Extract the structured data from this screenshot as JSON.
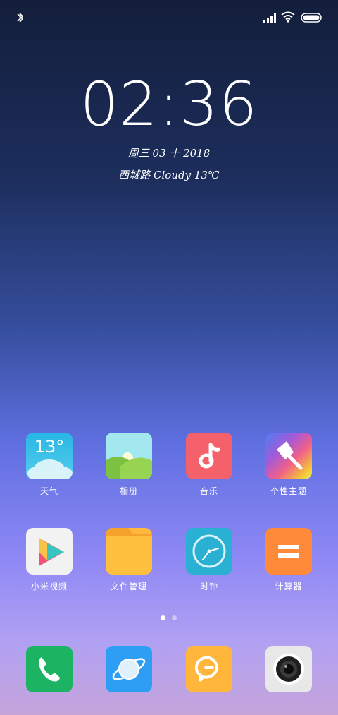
{
  "status_bar": {
    "icons": [
      "bluetooth-icon",
      "signal-icon",
      "wifi-icon",
      "battery-icon"
    ]
  },
  "lockscreen": {
    "time": "02:36",
    "date": "周三 03 十 2018",
    "weather": "西城路 Cloudy 13℃"
  },
  "apps_row1": [
    {
      "label": "天气",
      "icon": "weather-icon",
      "temp": "13°"
    },
    {
      "label": "相册",
      "icon": "gallery-icon"
    },
    {
      "label": "音乐",
      "icon": "music-icon"
    },
    {
      "label": "个性主题",
      "icon": "themes-icon"
    }
  ],
  "apps_row2": [
    {
      "label": "小米视频",
      "icon": "video-icon"
    },
    {
      "label": "文件管理",
      "icon": "file-manager-icon"
    },
    {
      "label": "时钟",
      "icon": "clock-icon"
    },
    {
      "label": "计算器",
      "icon": "calculator-icon"
    }
  ],
  "page_indicator": {
    "active": 1,
    "total": 2
  },
  "dock": [
    {
      "icon": "phone-icon"
    },
    {
      "icon": "browser-icon"
    },
    {
      "icon": "messages-icon"
    },
    {
      "icon": "camera-icon"
    }
  ],
  "colors": {
    "weather": "#3fc1e6",
    "gallery_sky": "#9fe6ef",
    "gallery_hill": "#8ccf45",
    "music": "#f5626b",
    "file": "#ffb93f",
    "clock": "#2fb2d4",
    "calculator": "#ff8a3a",
    "phone": "#1db463",
    "browser": "#2e9ff5",
    "messages": "#ffb63a",
    "camera": "#e8e8e8"
  }
}
